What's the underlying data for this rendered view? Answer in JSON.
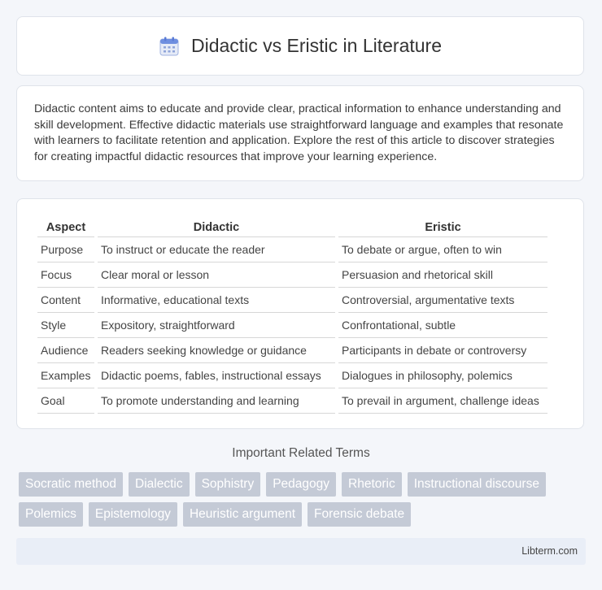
{
  "header": {
    "title": "Didactic vs Eristic in Literature",
    "icon": "calendar-icon"
  },
  "intro": {
    "text": "Didactic content aims to educate and provide clear, practical information to enhance understanding and skill development. Effective didactic materials use straightforward language and examples that resonate with learners to facilitate retention and application. Explore the rest of this article to discover strategies for creating impactful didactic resources that improve your learning experience."
  },
  "table": {
    "headers": [
      "Aspect",
      "Didactic",
      "Eristic"
    ],
    "rows": [
      [
        "Purpose",
        "To instruct or educate the reader",
        "To debate or argue, often to win"
      ],
      [
        "Focus",
        "Clear moral or lesson",
        "Persuasion and rhetorical skill"
      ],
      [
        "Content",
        "Informative, educational texts",
        "Controversial, argumentative texts"
      ],
      [
        "Style",
        "Expository, straightforward",
        "Confrontational, subtle"
      ],
      [
        "Audience",
        "Readers seeking knowledge or guidance",
        "Participants in debate or controversy"
      ],
      [
        "Examples",
        "Didactic poems, fables, instructional essays",
        "Dialogues in philosophy, polemics"
      ],
      [
        "Goal",
        "To promote understanding and learning",
        "To prevail in argument, challenge ideas"
      ]
    ]
  },
  "related": {
    "title": "Important Related Terms",
    "tags": [
      "Socratic method",
      "Dialectic",
      "Sophistry",
      "Pedagogy",
      "Rhetoric",
      "Instructional discourse",
      "Polemics",
      "Epistemology",
      "Heuristic argument",
      "Forensic debate"
    ]
  },
  "footer": {
    "text": "Libterm.com"
  }
}
